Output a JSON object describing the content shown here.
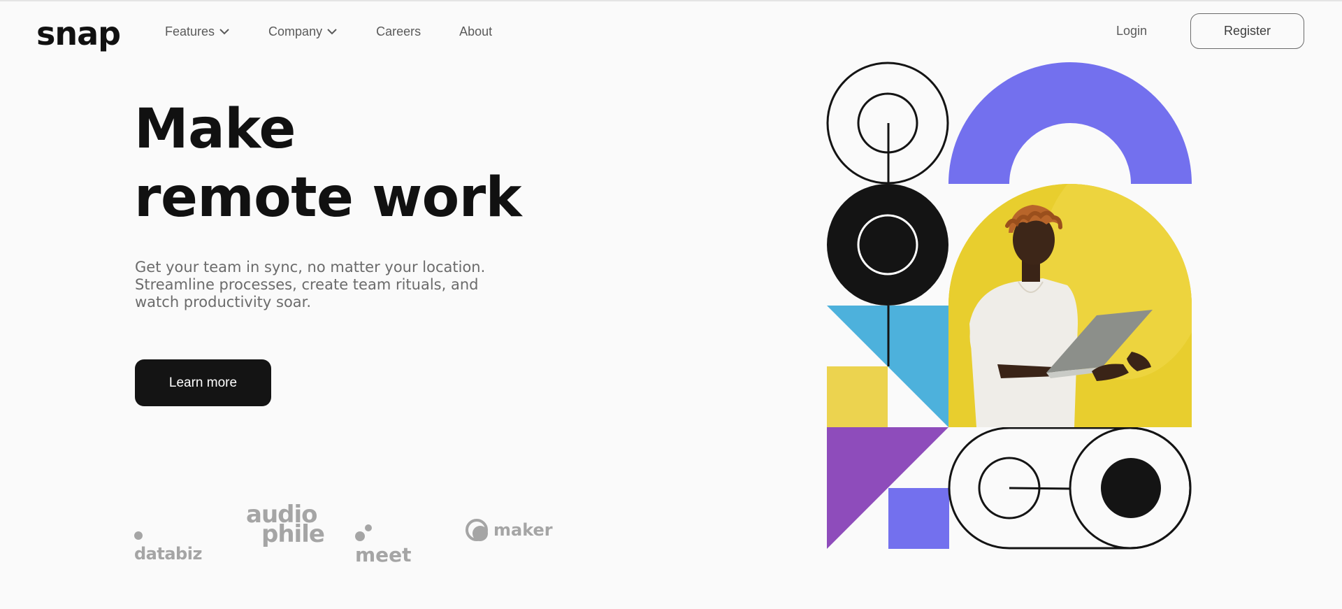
{
  "brand": {
    "logo": "snap"
  },
  "nav": {
    "items": [
      {
        "label": "Features",
        "has_dropdown": true
      },
      {
        "label": "Company",
        "has_dropdown": true
      },
      {
        "label": "Careers",
        "has_dropdown": false
      },
      {
        "label": "About",
        "has_dropdown": false
      }
    ],
    "login_label": "Login",
    "register_label": "Register"
  },
  "hero": {
    "headline_line1": "Make",
    "headline_line2": "remote work",
    "subtext": "Get your team in sync, no matter your location. Streamline processes, create team rituals, and watch productivity soar.",
    "cta_label": "Learn more"
  },
  "clients": {
    "databiz": "databiz",
    "audiophile_line1": "audio",
    "audiophile_line2": "phile",
    "meet": "meet",
    "maker": "maker"
  },
  "colors": {
    "background": "#fafafa",
    "text_dark": "#141414",
    "text_muted": "#6b6b6b",
    "purple_arch": "#7370ee",
    "photo_yellow": "#e7cd2b",
    "sky_blue": "#4db1dc",
    "yellow_square": "#ecd34f",
    "violet_triangle": "#8e4cbb",
    "client_gray": "#a5a5a5"
  },
  "icons": {
    "dropdown": "chevron-down-icon"
  }
}
